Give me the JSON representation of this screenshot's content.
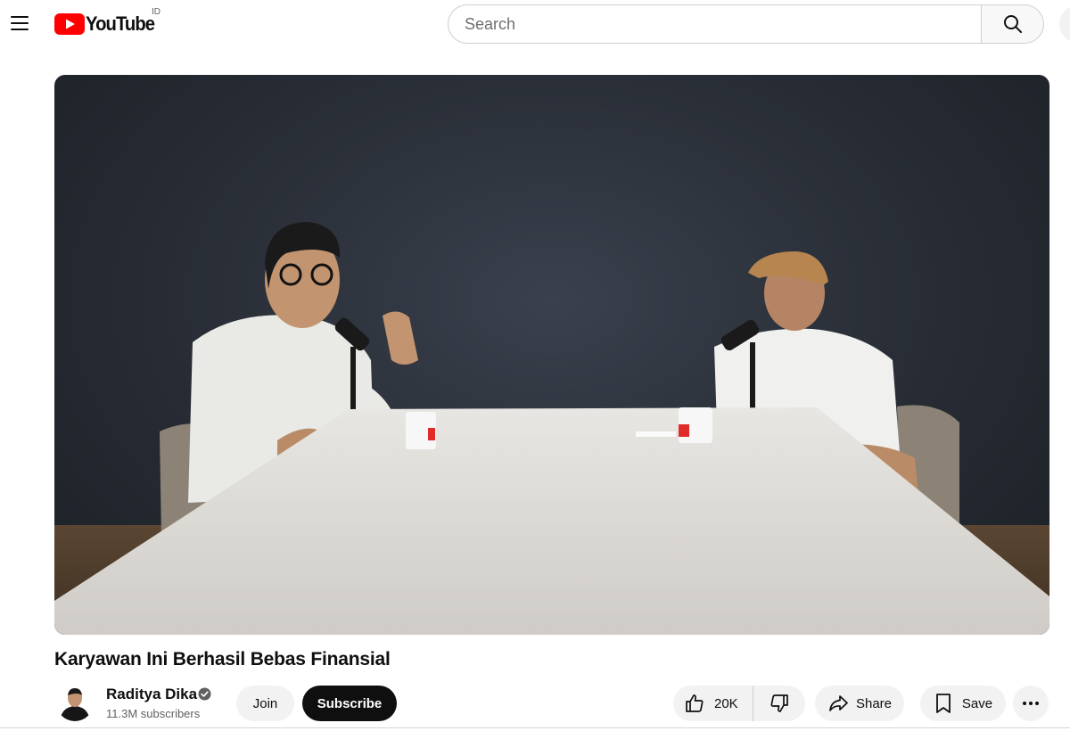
{
  "header": {
    "logo_text": "YouTube",
    "country_code": "ID",
    "search_placeholder": "Search"
  },
  "video": {
    "title": "Karyawan Ini Berhasil Bebas Finansial"
  },
  "owner": {
    "channel_name": "Raditya Dika",
    "subscribers": "11.3M subscribers",
    "join_label": "Join",
    "subscribe_label": "Subscribe"
  },
  "actions": {
    "like_count": "20K",
    "share_label": "Share",
    "save_label": "Save"
  },
  "icons": {
    "menu": "hamburger-icon",
    "search": "search-icon",
    "verified": "verified-check-icon",
    "like": "thumbs-up-icon",
    "dislike": "thumbs-down-icon",
    "share": "share-arrow-icon",
    "save": "bookmark-icon",
    "more": "more-horizontal-icon"
  },
  "colors": {
    "brand_red": "#ff0000",
    "subscribe_bg": "#0f0f0f",
    "pill_bg": "#f2f2f2"
  }
}
